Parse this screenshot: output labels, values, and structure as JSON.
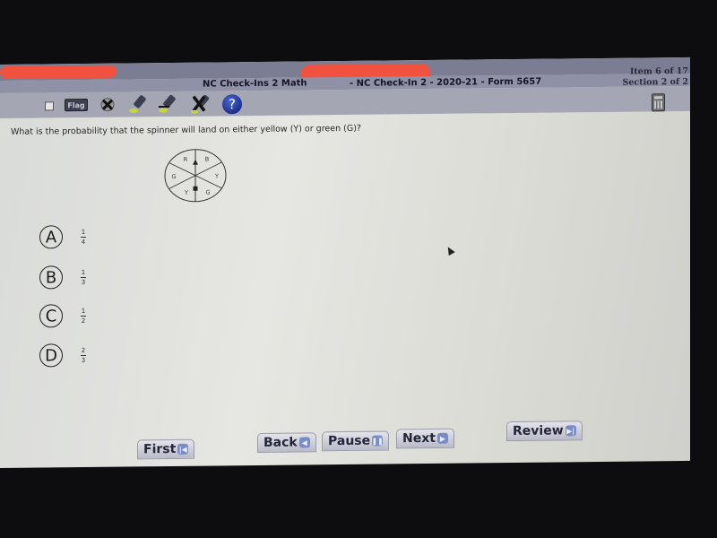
{
  "header": {
    "title_left": "NC Check-Ins 2 Math",
    "title_right": "- NC Check-In 2 - 2020-21 - Form 5657",
    "item_info": "Item 6 of 17",
    "section_info": "Section 2 of 2"
  },
  "toolbar": {
    "flag_label": "Flag",
    "help_label": "?",
    "tools": [
      "answer-eliminator",
      "highlighter",
      "highlighter-eraser",
      "clear-eliminations",
      "help",
      "calculator"
    ]
  },
  "question": {
    "text": "What is the probability that the spinner will land on either yellow (Y) or green (G)?",
    "spinner": {
      "sections": [
        "R",
        "B",
        "Y",
        "G",
        "Y",
        "G"
      ]
    }
  },
  "choices": [
    {
      "letter": "A",
      "numerator": "1",
      "denominator": "4"
    },
    {
      "letter": "B",
      "numerator": "1",
      "denominator": "3"
    },
    {
      "letter": "C",
      "numerator": "1",
      "denominator": "2"
    },
    {
      "letter": "D",
      "numerator": "2",
      "denominator": "3"
    }
  ],
  "navigation": {
    "first": "First",
    "back": "Back",
    "pause": "Pause",
    "next": "Next",
    "review": "Review"
  }
}
